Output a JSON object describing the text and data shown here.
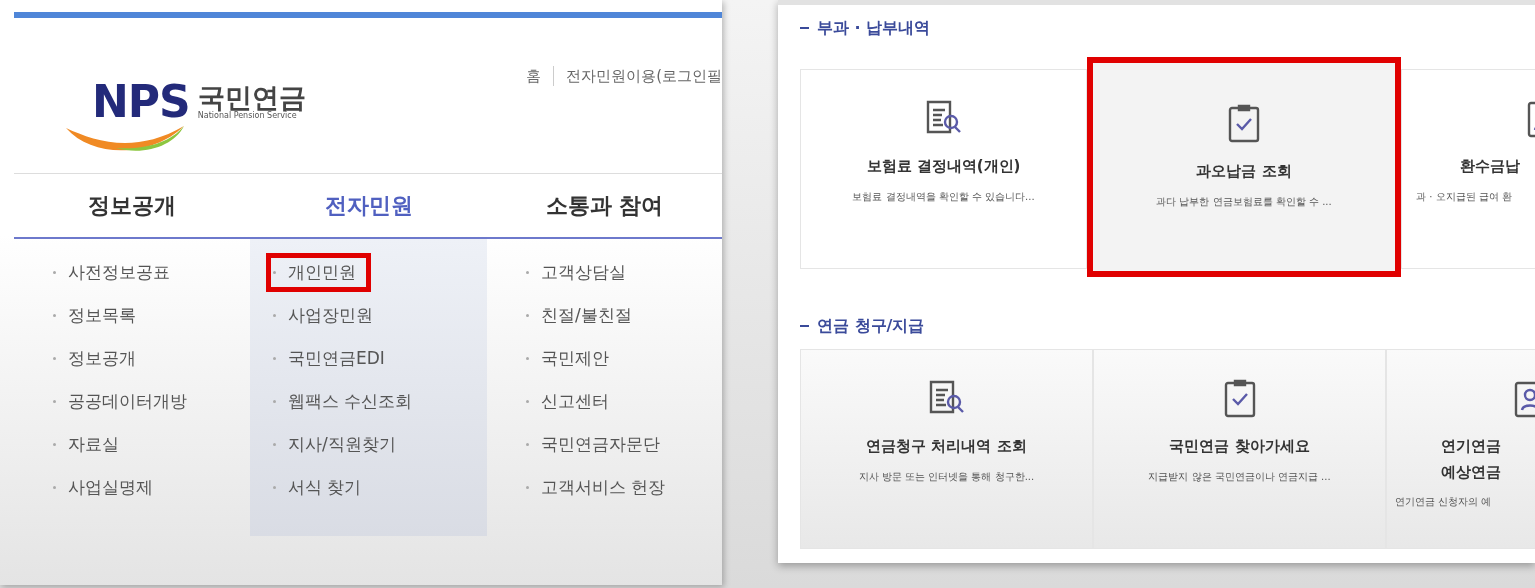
{
  "left_page": {
    "logo": {
      "mark": "NPS",
      "name": "국민연금",
      "subtitle": "National Pension Service"
    },
    "top_links": [
      "홈",
      "전자민원이용(로그인필"
    ],
    "nav": [
      {
        "label": "정보공개",
        "selected": false,
        "items": [
          {
            "label": "사전정보공표",
            "highlighted": false
          },
          {
            "label": "정보목록",
            "highlighted": false
          },
          {
            "label": "정보공개",
            "highlighted": false
          },
          {
            "label": "공공데이터개방",
            "highlighted": false
          },
          {
            "label": "자료실",
            "highlighted": false
          },
          {
            "label": "사업실명제",
            "highlighted": false
          }
        ]
      },
      {
        "label": "전자민원",
        "selected": true,
        "items": [
          {
            "label": "개인민원",
            "highlighted": true
          },
          {
            "label": "사업장민원",
            "highlighted": false
          },
          {
            "label": "국민연금EDI",
            "highlighted": false
          },
          {
            "label": "웹팩스 수신조회",
            "highlighted": false
          },
          {
            "label": "지사/직원찾기",
            "highlighted": false
          },
          {
            "label": "서식 찾기",
            "highlighted": false
          }
        ]
      },
      {
        "label": "소통과 참여",
        "selected": false,
        "items": [
          {
            "label": "고객상담실",
            "highlighted": false
          },
          {
            "label": "친절/불친절",
            "highlighted": false
          },
          {
            "label": "국민제안",
            "highlighted": false
          },
          {
            "label": "신고센터",
            "highlighted": false
          },
          {
            "label": "국민연금자문단",
            "highlighted": false
          },
          {
            "label": "고객서비스 헌장",
            "highlighted": false
          }
        ]
      }
    ]
  },
  "right_page": {
    "sections": [
      {
        "title": "부과 · 납부내역",
        "cards": [
          {
            "kind": "doc-search",
            "title": "보험료 결정내역(개인)",
            "description": "보험료 결정내역을 확인할 수 있습니다...",
            "highlighted": false
          },
          {
            "kind": "clipboard-check",
            "title": "과오납금 조회",
            "description": "과다 납부한 연금보험료를 확인할 수 ...",
            "highlighted": true
          },
          {
            "kind": "person-doc",
            "title": "환수금납",
            "description": "과 · 오지급된 급여 환",
            "highlighted": false
          }
        ]
      },
      {
        "title": "연금 청구/지급",
        "cards": [
          {
            "kind": "doc-search",
            "title": "연금청구 처리내역 조회",
            "description": "지사 방문 또는 인터넷을 통해 청구한...",
            "highlighted": false
          },
          {
            "kind": "clipboard-check",
            "title": "국민연금 찾아가세요",
            "description": "지급받지 않은 국민연금이나 연금지급 ...",
            "highlighted": false
          },
          {
            "kind": "person-doc",
            "title": "연기연금\n예상연금",
            "description": "연기연금 신청자의 예",
            "highlighted": false
          }
        ]
      }
    ]
  }
}
